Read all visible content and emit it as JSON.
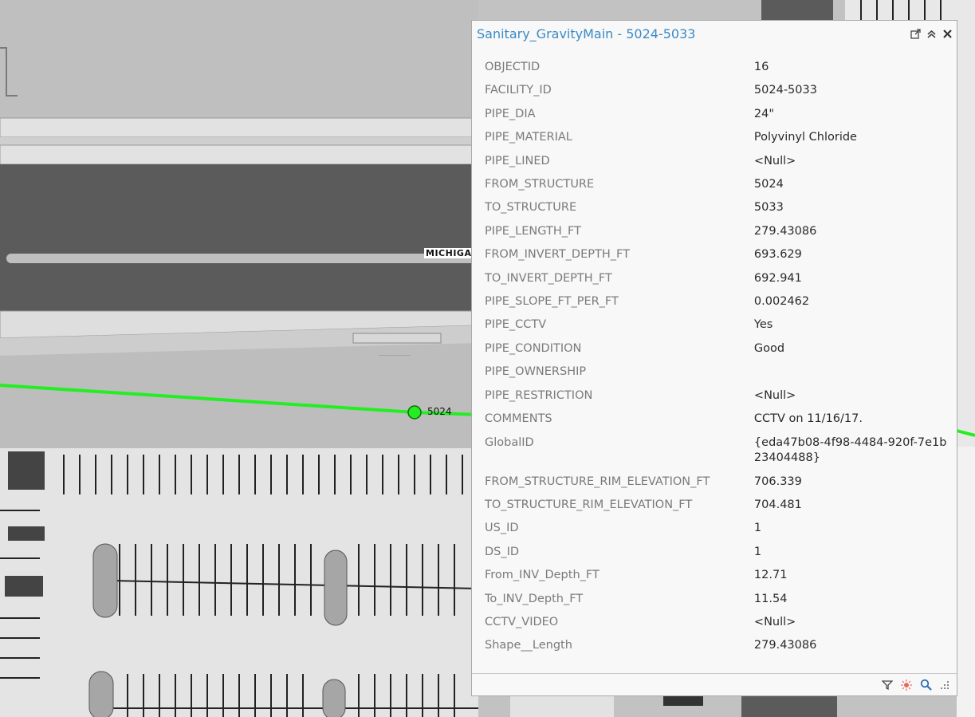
{
  "map": {
    "street_label": "MICHIGA",
    "structure_label": "5024",
    "pipe_color": "#22ee22"
  },
  "popup": {
    "title": "Sanitary_GravityMain - 5024-5033",
    "title_color": "#3a8ac6",
    "title_buttons": [
      "pop-out-icon",
      "collapse-icon",
      "close-icon"
    ],
    "fields": [
      {
        "name": "OBJECTID",
        "value": "16"
      },
      {
        "name": "FACILITY_ID",
        "value": "5024-5033"
      },
      {
        "name": "PIPE_DIA",
        "value": "24\""
      },
      {
        "name": "PIPE_MATERIAL",
        "value": "Polyvinyl Chloride"
      },
      {
        "name": "PIPE_LINED",
        "value": "<Null>"
      },
      {
        "name": "FROM_STRUCTURE",
        "value": "5024"
      },
      {
        "name": "TO_STRUCTURE",
        "value": "5033"
      },
      {
        "name": "PIPE_LENGTH_FT",
        "value": "279.43086"
      },
      {
        "name": "FROM_INVERT_DEPTH_FT",
        "value": "693.629"
      },
      {
        "name": "TO_INVERT_DEPTH_FT",
        "value": "692.941"
      },
      {
        "name": "PIPE_SLOPE_FT_PER_FT",
        "value": "0.002462"
      },
      {
        "name": "PIPE_CCTV",
        "value": "Yes"
      },
      {
        "name": "PIPE_CONDITION",
        "value": "Good"
      },
      {
        "name": "PIPE_OWNERSHIP",
        "value": ""
      },
      {
        "name": "PIPE_RESTRICTION",
        "value": "<Null>"
      },
      {
        "name": "COMMENTS",
        "value": "CCTV on 11/16/17."
      },
      {
        "name": "GlobalID",
        "value": "{eda47b08-4f98-4484-920f-7e1b23404488}"
      },
      {
        "name": "FROM_STRUCTURE_RIM_ELEVATION_FT",
        "value": "706.339"
      },
      {
        "name": "TO_STRUCTURE_RIM_ELEVATION_FT",
        "value": "704.481"
      },
      {
        "name": "US_ID",
        "value": "1"
      },
      {
        "name": "DS_ID",
        "value": "1"
      },
      {
        "name": "From_INV_Depth_FT",
        "value": "12.71"
      },
      {
        "name": "To_INV_Depth_FT",
        "value": "11.54"
      },
      {
        "name": "CCTV_VIDEO",
        "value": "<Null>"
      },
      {
        "name": "Shape__Length",
        "value": "279.43086"
      }
    ],
    "footer_buttons": [
      "filter-icon",
      "flash-icon",
      "zoom-to-icon",
      "resize-grip-icon"
    ]
  }
}
